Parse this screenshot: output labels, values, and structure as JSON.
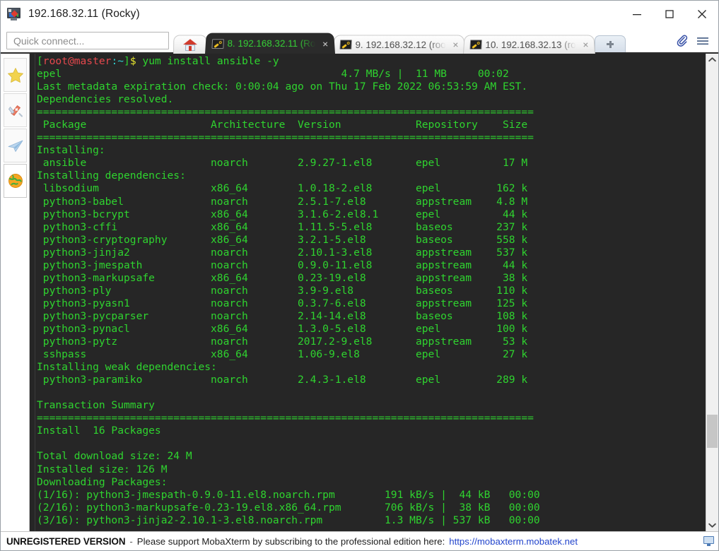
{
  "window": {
    "title": "192.168.32.11 (Rocky)",
    "logo_icon": "mobaxterm-logo-icon",
    "controls": {
      "minimize": "minimize-icon",
      "maximize": "maximize-icon",
      "close": "close-icon"
    }
  },
  "toolbar": {
    "quick_connect_placeholder": "Quick connect...",
    "new_tab_label": "+",
    "attach_icon": "paperclip-icon",
    "menu_icon": "hamburger-menu-icon"
  },
  "tabs": [
    {
      "id": "home",
      "icon": "home-icon",
      "label": "",
      "active": false,
      "closable": false
    },
    {
      "id": "t8",
      "icon": "ssh-key-icon",
      "label": "8. 192.168.32.11 (Ro",
      "active": true,
      "closable": true,
      "close": "×"
    },
    {
      "id": "t9",
      "icon": "ssh-key-icon",
      "label": "9. 192.168.32.12 (roo",
      "active": false,
      "closable": true,
      "close": "×"
    },
    {
      "id": "t10",
      "icon": "ssh-key-icon",
      "label": "10. 192.168.32.13 (ro",
      "active": false,
      "closable": true,
      "close": "×"
    }
  ],
  "sidebar": {
    "items": [
      {
        "id": "favorites",
        "icon": "star-icon"
      },
      {
        "id": "tools",
        "icon": "swiss-army-knife-icon"
      },
      {
        "id": "sftp-send",
        "icon": "paper-plane-icon"
      },
      {
        "id": "web",
        "icon": "globe-icon",
        "selected": true
      }
    ]
  },
  "terminal": {
    "prompt": {
      "bracket_open": "[",
      "user_host": "root@master",
      "path": ":~",
      "bracket_close": "]",
      "sigil": "$",
      "command": " yum install ansible -y"
    },
    "lines": [
      "epel                                             4.7 MB/s |  11 MB     00:02",
      "Last metadata expiration check: 0:00:04 ago on Thu 17 Feb 2022 06:53:59 AM EST.",
      "Dependencies resolved.",
      "================================================================================",
      " Package                    Architecture  Version            Repository    Size",
      "================================================================================",
      "Installing:",
      " ansible                    noarch        2.9.27-1.el8       epel          17 M",
      "Installing dependencies:",
      " libsodium                  x86_64        1.0.18-2.el8       epel         162 k",
      " python3-babel              noarch        2.5.1-7.el8        appstream    4.8 M",
      " python3-bcrypt             x86_64        3.1.6-2.el8.1      epel          44 k",
      " python3-cffi               x86_64        1.11.5-5.el8       baseos       237 k",
      " python3-cryptography       x86_64        3.2.1-5.el8        baseos       558 k",
      " python3-jinja2             noarch        2.10.1-3.el8       appstream    537 k",
      " python3-jmespath           noarch        0.9.0-11.el8       appstream     44 k",
      " python3-markupsafe         x86_64        0.23-19.el8        appstream     38 k",
      " python3-ply                noarch        3.9-9.el8          baseos       110 k",
      " python3-pyasn1             noarch        0.3.7-6.el8        appstream    125 k",
      " python3-pycparser          noarch        2.14-14.el8        baseos       108 k",
      " python3-pynacl             x86_64        1.3.0-5.el8        epel         100 k",
      " python3-pytz               noarch        2017.2-9.el8       appstream     53 k",
      " sshpass                    x86_64        1.06-9.el8         epel          27 k",
      "Installing weak dependencies:",
      " python3-paramiko           noarch        2.4.3-1.el8        epel         289 k",
      "",
      "Transaction Summary",
      "================================================================================",
      "Install  16 Packages",
      "",
      "Total download size: 24 M",
      "Installed size: 126 M",
      "Downloading Packages:",
      "(1/16): python3-jmespath-0.9.0-11.el8.noarch.rpm        191 kB/s |  44 kB   00:00",
      "(2/16): python3-markupsafe-0.23-19.el8.x86_64.rpm       706 kB/s |  38 kB   00:00",
      "(3/16): python3-jinja2-2.10.1-3.el8.noarch.rpm          1.3 MB/s | 537 kB   00:00"
    ],
    "colors": {
      "background": "#262626",
      "foreground": "#2fd42f",
      "prompt_user": "#e5484d",
      "prompt_path": "#2fd4d4",
      "prompt_sigil": "#e5e52f",
      "command": "#4d9ee5"
    }
  },
  "scrollbar": {
    "up_arrow": "chevron-up-icon",
    "down_arrow": "chevron-down-icon"
  },
  "statusbar": {
    "unregistered": "UNREGISTERED VERSION",
    "dash": "-",
    "message": "Please support MobaXterm by subscribing to the professional edition here:",
    "link": "https://mobaxterm.mobatek.net",
    "monitor_icon": "display-icon"
  }
}
